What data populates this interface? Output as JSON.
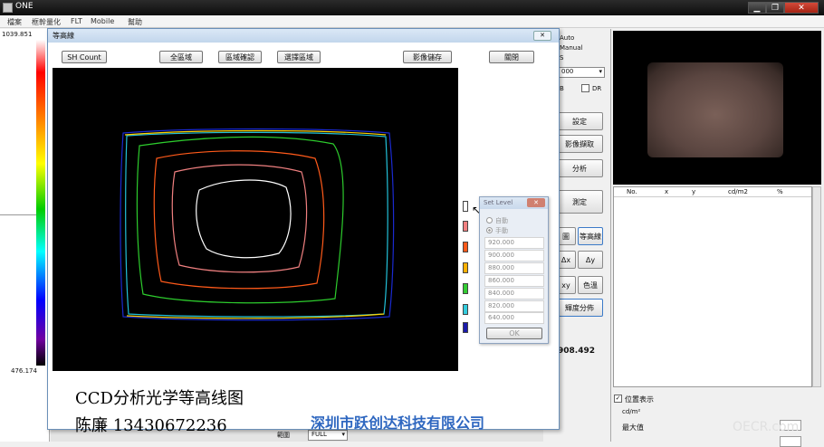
{
  "app": {
    "title": "ONE",
    "menu": [
      "檔案",
      "框幹量化",
      "FLT",
      "Mobile",
      "幫助"
    ]
  },
  "colorbar": {
    "max": "1039.851",
    "min": "476.174"
  },
  "dialog": {
    "title": "等高線",
    "buttons": {
      "sh_count": "SH Count",
      "all_region": "全區域",
      "region_confirm": "區域確認",
      "select_region": "選擇區域",
      "save_image": "影像儲存",
      "close": "關閉"
    },
    "level_colors": [
      "#ffffff",
      "#f08080",
      "#ff5a1a",
      "#ffb000",
      "#33cc33",
      "#33ccdd",
      "#1a1aaa"
    ]
  },
  "set_level": {
    "title": "Set Level",
    "mode_auto": "自動",
    "mode_manual": "手動",
    "levels": [
      "920.000",
      "900.000",
      "880.000",
      "860.000",
      "840.000",
      "820.000",
      "640.000"
    ],
    "ok": "OK"
  },
  "right_panel": {
    "auto": "Auto",
    "manual": "Manual",
    "s": "S",
    "dropdown_value": "000",
    "b": "B",
    "dr": "DR",
    "settings": "設定",
    "image_capture": "影像擷取",
    "analysis": "分析",
    "measure": "測定",
    "hist": "圖",
    "contour": "等高線",
    "dx": "Δx",
    "dy": "Δy",
    "xy": "xy",
    "color": "色溫",
    "luminance_dist": "輝度分佈",
    "value": "908.492",
    "table_headers": [
      "No.",
      "x",
      "y",
      "cd/m2",
      "%"
    ],
    "position_display": "位置表示",
    "unit": "cd/m²",
    "max_label": "最大值",
    "range_label": "範圍",
    "range_value": "FULL"
  },
  "caption": {
    "line1": "CCD分析光学等高线图",
    "line2": "陈廉 13430672236",
    "company": "深圳市跃创达科技有限公司",
    "watermark": "OECR.com"
  }
}
